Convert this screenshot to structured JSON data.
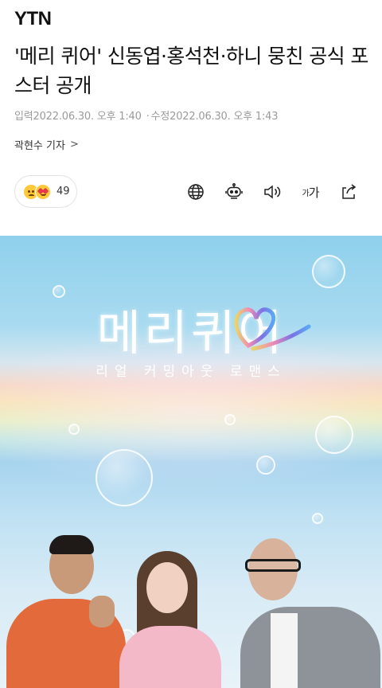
{
  "header": {
    "logo": "YTN"
  },
  "article": {
    "headline": "'메리 퀴어' 신동엽·홍석천·하니 뭉친 공식 포스터 공개",
    "published_label": "입력",
    "published_time": "2022.06.30. 오후 1:40",
    "separator": "·",
    "modified_label": "수정",
    "modified_time": "2022.06.30. 오후 1:43",
    "author": "곽현수 기자",
    "author_chevron": ">"
  },
  "reactions": {
    "count": "49",
    "emojis": [
      "sad-face-icon",
      "heart-eyes-icon"
    ]
  },
  "toolbar": {
    "font_small": "가",
    "font_large": "가",
    "icons": [
      "globe-icon",
      "robot-icon",
      "speaker-icon",
      "font-size-icon",
      "share-icon"
    ]
  },
  "poster": {
    "title": "메리퀴어",
    "subtitle": "리얼 커밍아웃 로맨스",
    "colors": {
      "sky": "#9fd6ee",
      "heart_gradient": [
        "#e9d36a",
        "#f08cb4",
        "#7a72e6",
        "#5aa9f5"
      ]
    }
  }
}
